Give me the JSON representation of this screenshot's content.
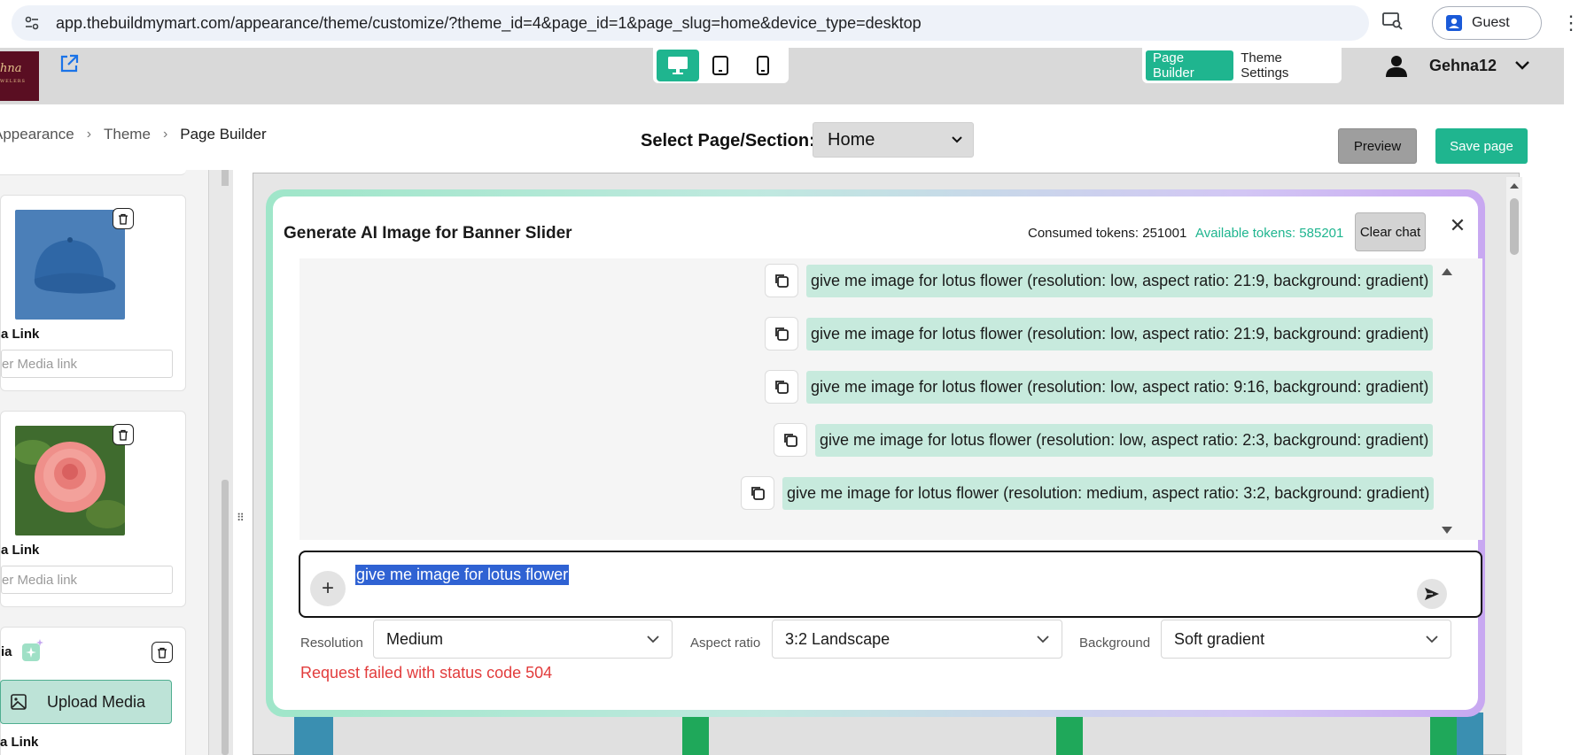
{
  "browser": {
    "url": "app.thebuildmymart.com/appearance/theme/customize/?theme_id=4&page_id=1&page_slug=home&device_type=desktop",
    "profile_label": "Guest"
  },
  "appbar": {
    "logo_text": "hna",
    "logo_sub": "WELERS",
    "modes": [
      "Page Builder",
      "Theme Settings"
    ],
    "user_name": "Gehna12"
  },
  "breadcrumb": {
    "items": [
      "Appearance",
      "Theme",
      "Page Builder"
    ]
  },
  "toolbar": {
    "select_label": "Select Page/Section:",
    "selected_page": "Home",
    "preview_label": "Preview",
    "save_label": "Save page"
  },
  "left_panel": {
    "link_label": "a Link",
    "link_placeholder": "er Media link",
    "media_label": "ia",
    "upload_label": "Upload Media",
    "bottom_link_label": "a Link"
  },
  "modal": {
    "title": "Generate AI Image for Banner Slider",
    "consumed_tokens": "Consumed tokens: 251001",
    "available_tokens": "Available tokens: 585201",
    "clear_chat_label": "Clear chat",
    "messages": [
      "give me image for lotus flower (resolution: low, aspect ratio: 21:9, background: gradient)",
      "give me image for lotus flower (resolution: low, aspect ratio: 21:9, background: gradient)",
      "give me image for lotus flower (resolution: low, aspect ratio: 9:16, background: gradient)",
      "give me image for lotus flower (resolution: low, aspect ratio: 2:3, background: gradient)",
      "give me image for lotus flower (resolution: medium, aspect ratio: 3:2, background: gradient)"
    ],
    "prompt_value": "give me image for lotus flower",
    "options": {
      "resolution_label": "Resolution",
      "resolution_value": "Medium",
      "aspect_label": "Aspect ratio",
      "aspect_value": "3:2 Landscape",
      "background_label": "Background",
      "background_value": "Soft gradient"
    },
    "error": "Request failed with status code 504"
  },
  "colors": {
    "accent": "#1fb58f",
    "bubble": "#c7eadd",
    "error": "#e23c3c",
    "selection": "#2f62d3"
  }
}
